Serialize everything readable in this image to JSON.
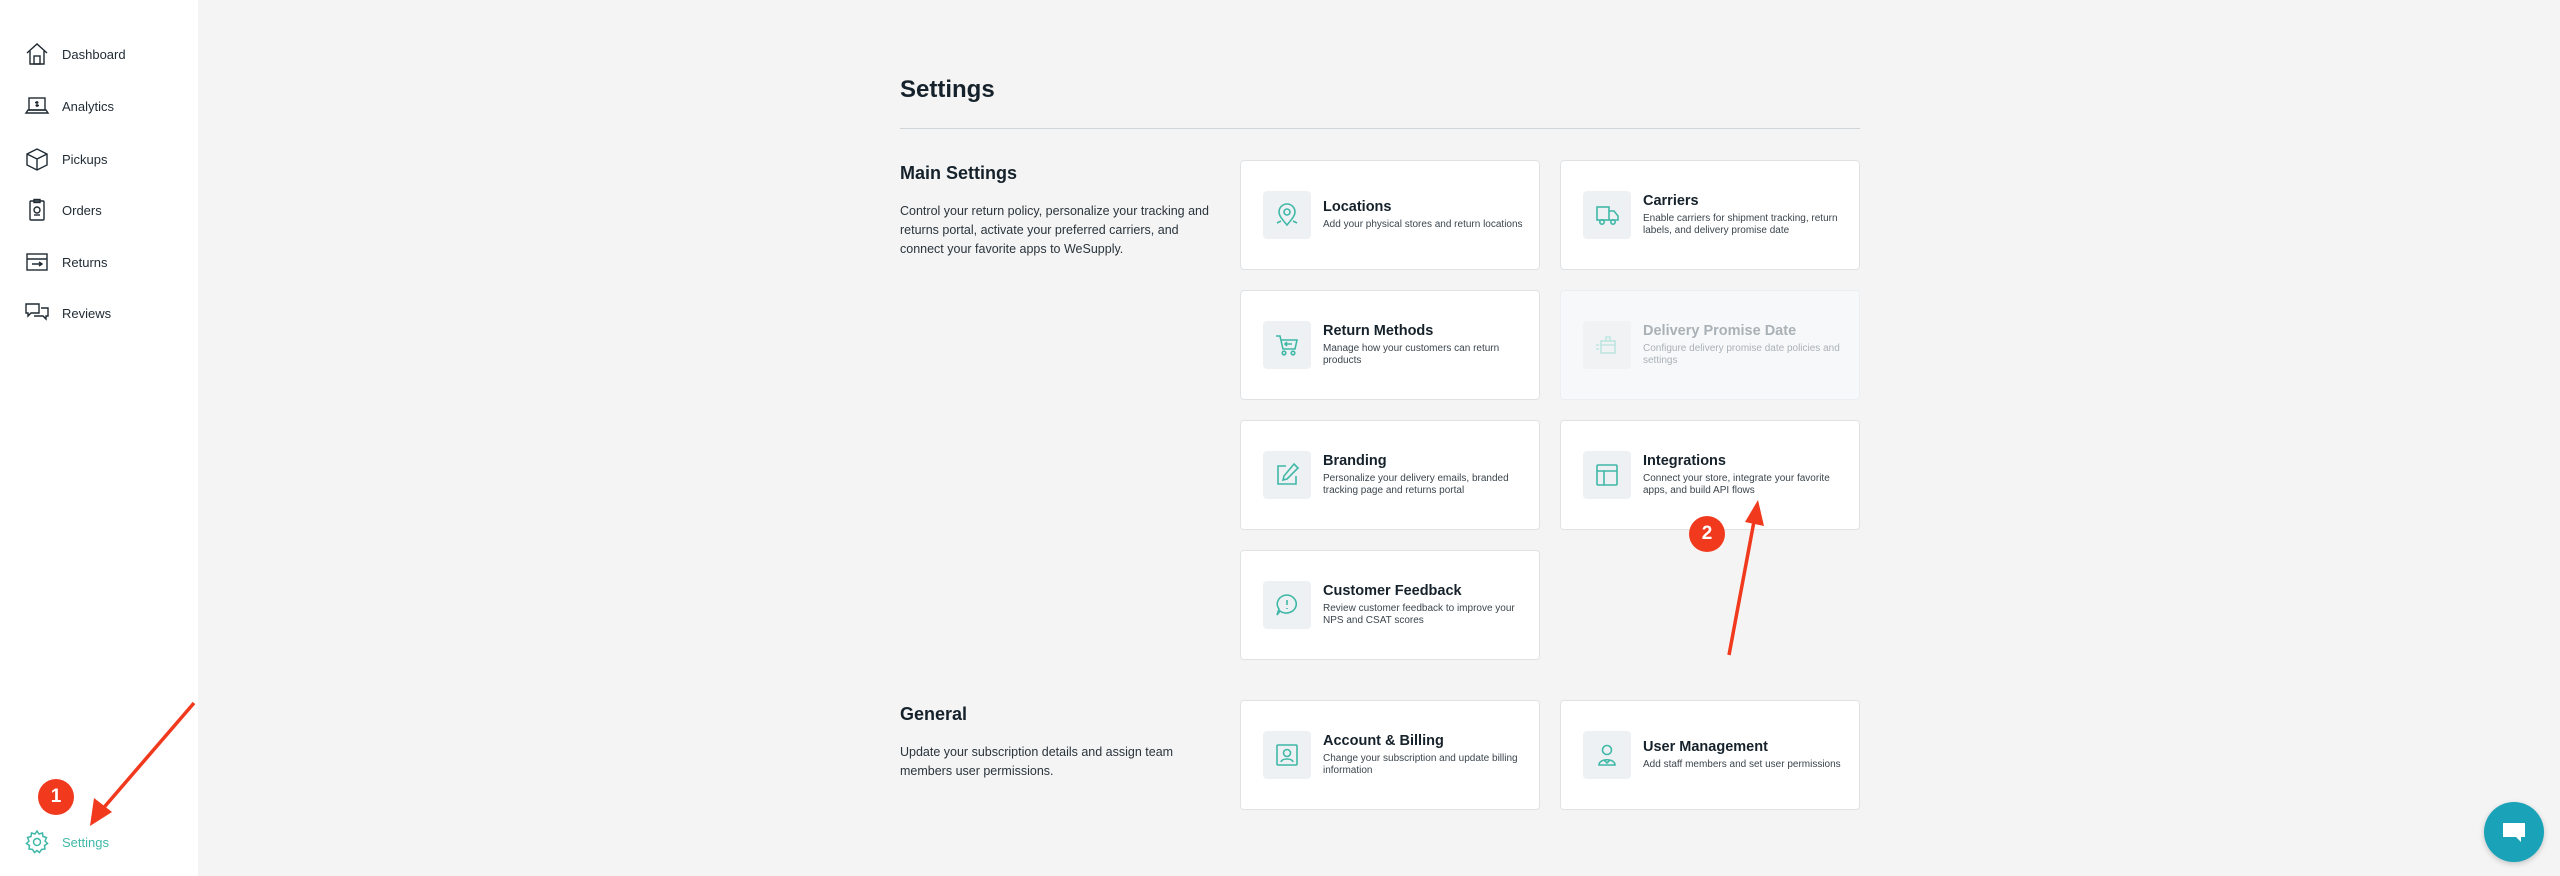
{
  "sidebar": {
    "items": [
      {
        "label": "Dashboard",
        "icon": "house-icon"
      },
      {
        "label": "Analytics",
        "icon": "laptop-dollar-icon"
      },
      {
        "label": "Pickups",
        "icon": "box-icon"
      },
      {
        "label": "Orders",
        "icon": "clipboard-icon"
      },
      {
        "label": "Returns",
        "icon": "returns-icon"
      },
      {
        "label": "Reviews",
        "icon": "chat-bubbles-icon"
      }
    ],
    "settings_label": "Settings"
  },
  "page": {
    "title": "Settings"
  },
  "main_settings": {
    "title": "Main Settings",
    "description": "Control your return policy, personalize your tracking and returns portal, activate your preferred carriers, and connect your favorite apps to WeSupply.",
    "cards": [
      {
        "title": "Locations",
        "desc": "Add your physical stores and return locations",
        "icon": "map-pin-icon",
        "disabled": false
      },
      {
        "title": "Carriers",
        "desc": "Enable carriers for shipment tracking, return labels, and delivery promise date",
        "icon": "truck-icon",
        "disabled": false
      },
      {
        "title": "Return Methods",
        "desc": "Manage how your customers can return products",
        "icon": "cart-return-icon",
        "disabled": false
      },
      {
        "title": "Delivery Promise Date",
        "desc": "Configure delivery promise date policies and settings",
        "icon": "delivery-box-icon",
        "disabled": true
      },
      {
        "title": "Branding",
        "desc": "Personalize your delivery emails, branded tracking page and returns portal",
        "icon": "edit-icon",
        "disabled": false
      },
      {
        "title": "Integrations",
        "desc": "Connect your store, integrate your favorite apps, and build API flows",
        "icon": "layout-icon",
        "disabled": false
      },
      {
        "title": "Customer Feedback",
        "desc": "Review customer feedback to improve your NPS and CSAT scores",
        "icon": "feedback-icon",
        "disabled": false
      }
    ]
  },
  "general": {
    "title": "General",
    "description": "Update your subscription details and assign team members user permissions.",
    "cards": [
      {
        "title": "Account & Billing",
        "desc": "Change your subscription and update billing information",
        "icon": "account-icon",
        "disabled": false
      },
      {
        "title": "User Management",
        "desc": "Add staff members and set user permissions",
        "icon": "user-icon",
        "disabled": false
      }
    ]
  },
  "annotations": {
    "badge_1": "1",
    "badge_2": "2",
    "color": "#f0391d"
  },
  "colors": {
    "accent": "#3fb8a7",
    "chat": "#1aa3b8"
  }
}
